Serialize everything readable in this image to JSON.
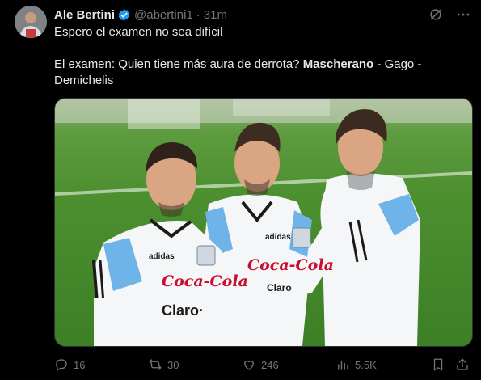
{
  "tweet": {
    "author_name": "Ale Bertini",
    "handle": "@abertini1",
    "separator": "·",
    "time": "31m",
    "line1": "Espero el examen no sea difícil",
    "line2_prefix": "El examen: Quien tiene más aura de derrota? ",
    "line2_bold": "Mascherano",
    "line2_suffix": " - Gago -",
    "line3": "Demichelis"
  },
  "media": {
    "shirt_sponsor_left": "Coca-Cola",
    "shirt_sponsor_left_2": "Claro·",
    "shirt_sponsor_center": "Coca-Cola",
    "shirt_sponsor_center_2": "Claro"
  },
  "actions": {
    "replies": "16",
    "reposts": "30",
    "likes": "246",
    "views": "5.5K"
  },
  "colors": {
    "background": "#000000",
    "text": "#e7e9ea",
    "muted": "#71767b",
    "verified": "#1d9bf0"
  }
}
